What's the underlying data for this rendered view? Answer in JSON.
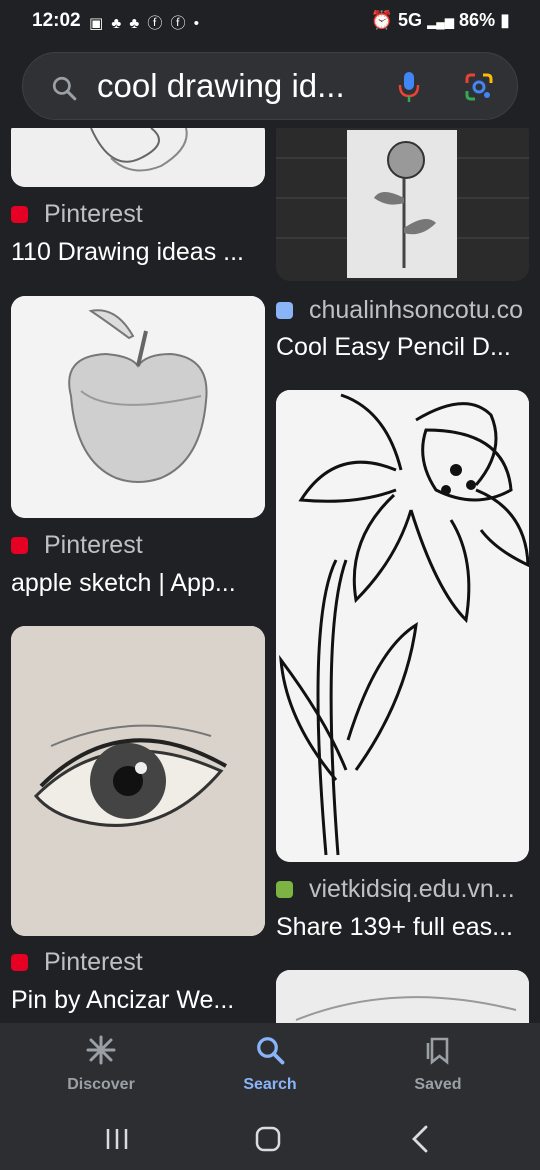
{
  "status_bar": {
    "time": "12:02",
    "network": "5G",
    "battery": "86%"
  },
  "search": {
    "query": "cool drawing id..."
  },
  "results": {
    "col1": [
      {
        "source": "Pinterest",
        "title": "110 Drawing ideas ..."
      },
      {
        "source": "Pinterest",
        "title": "apple sketch | App..."
      },
      {
        "source": "Pinterest",
        "title": "Pin by Ancizar We..."
      }
    ],
    "col2": [
      {
        "source": "chualinhsoncotu.co",
        "title": "Cool Easy Pencil D..."
      },
      {
        "source": "vietkidsiq.edu.vn...",
        "title": "Share 139+ full eas..."
      }
    ]
  },
  "bottom_nav": {
    "discover": "Discover",
    "search": "Search",
    "saved": "Saved"
  },
  "colors": {
    "background": "#202124",
    "accent": "#8ab4f8",
    "pinterest": "#e60023"
  }
}
